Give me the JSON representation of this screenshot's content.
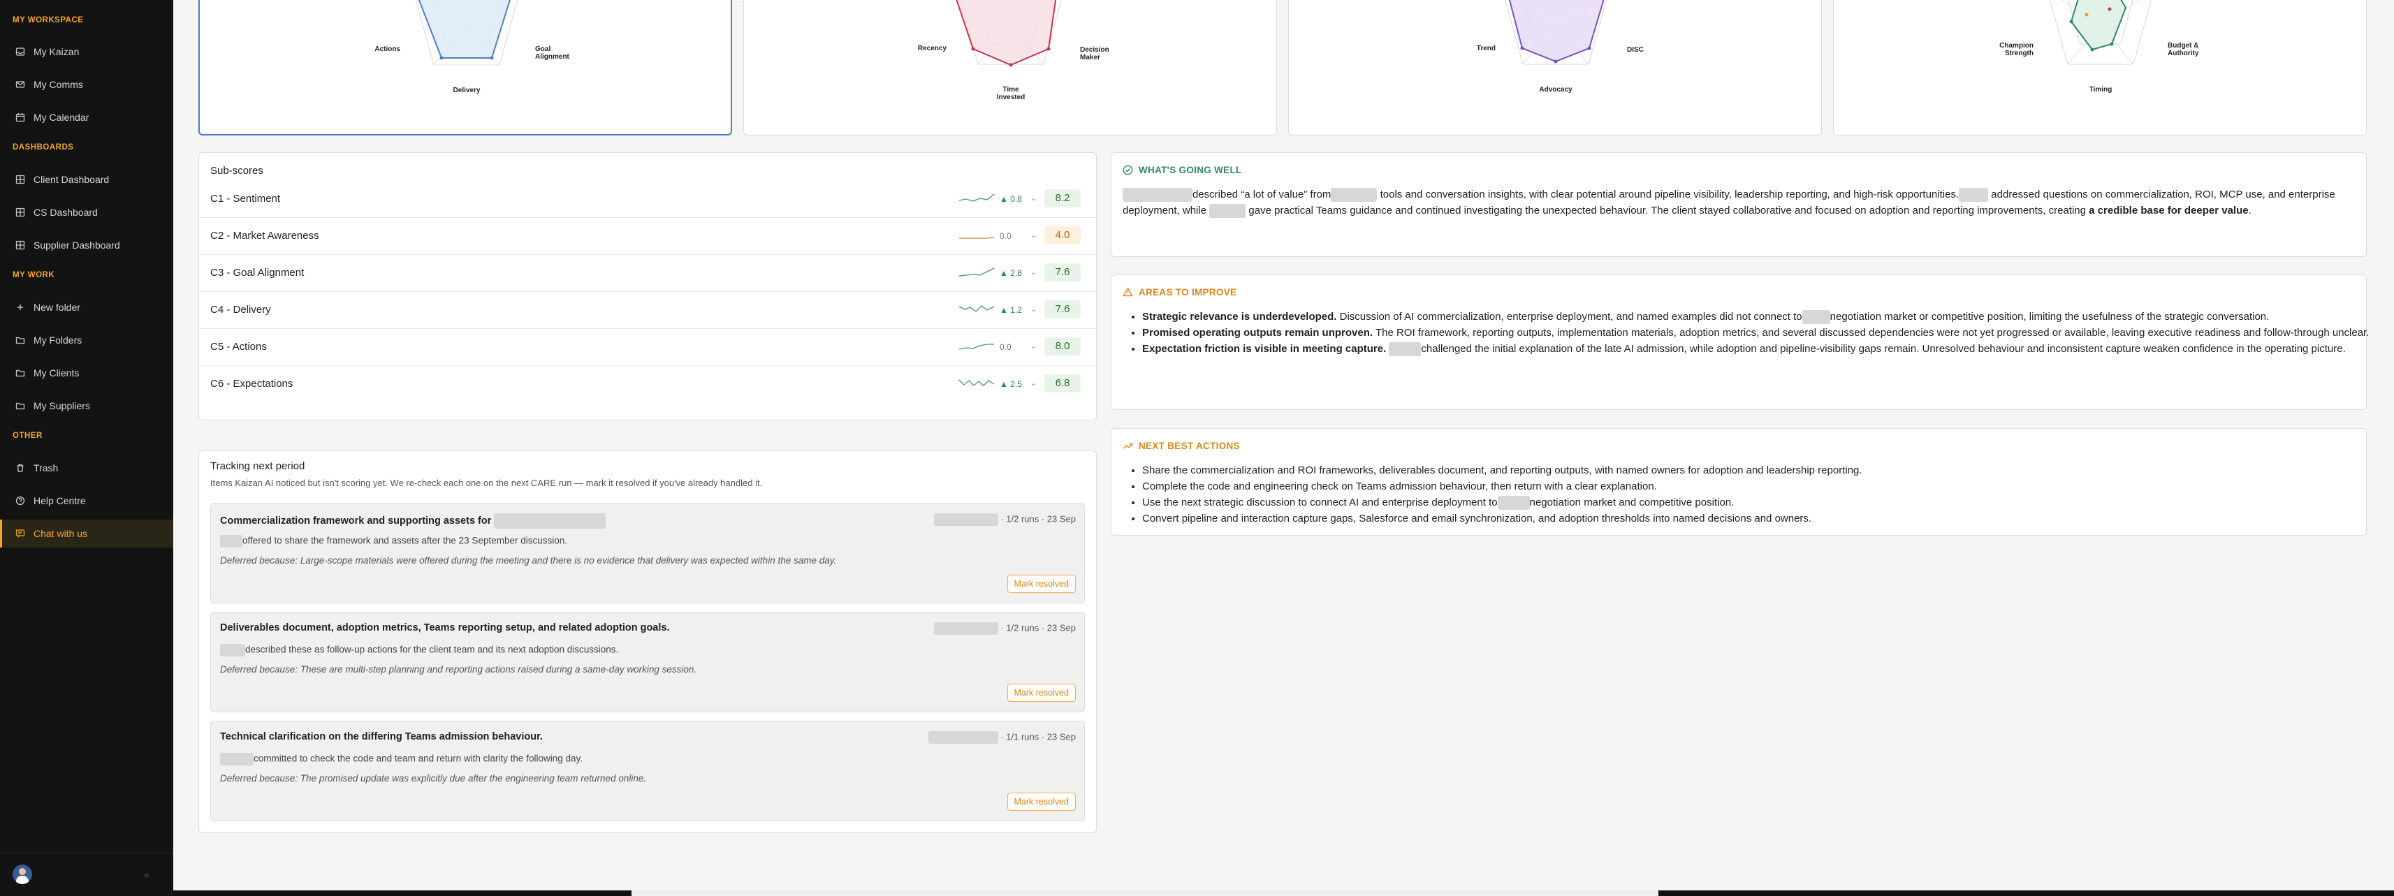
{
  "sidebar": {
    "sections": {
      "workspace": "MY WORKSPACE",
      "dashboards": "DASHBOARDS",
      "work": "MY WORK",
      "other": "OTHER"
    },
    "items": {
      "my_kaizan": "My Kaizan",
      "my_comms": "My Comms",
      "my_calendar": "My Calendar",
      "client_dashboard": "Client Dashboard",
      "cs_dashboard": "CS Dashboard",
      "supplier_dashboard": "Supplier Dashboard",
      "new_folder": "New folder",
      "my_folders": "My Folders",
      "my_clients": "My Clients",
      "my_suppliers": "My Suppliers",
      "trash": "Trash",
      "help_centre": "Help Centre",
      "chat_with_us": "Chat with us"
    },
    "collapse_icon": "chevron-double-left-icon",
    "accent": "#f5a623"
  },
  "radars": [
    {
      "labels": {
        "left": "Actions",
        "right": "Goal Alignment",
        "bottom": "Delivery"
      },
      "color": "#4a7fc1",
      "fill": "#dce8f6"
    },
    {
      "labels": {
        "left": "Recency",
        "right": "Decision Maker",
        "bottom": "Time Invested"
      },
      "color": "#c0394b",
      "fill": "#f6dde2"
    },
    {
      "labels": {
        "left": "Trend",
        "right": "DISC",
        "bottom": "Advocacy"
      },
      "color": "#7a4fc3",
      "fill": "#e7dcf6"
    },
    {
      "labels": {
        "left": "Champion Strength",
        "right": "Budget & Authority",
        "bottom": "Timing"
      },
      "color": "#2f8a5f",
      "fill": "#dcf0e5"
    }
  ],
  "subscores": {
    "title": "Sub-scores",
    "rows": [
      {
        "label": "C1 - Sentiment",
        "delta": "▲ 0.8",
        "score": "8.2",
        "tone": "green"
      },
      {
        "label": "C2 - Market Awareness",
        "delta": "0.0",
        "score": "4.0",
        "tone": "orange"
      },
      {
        "label": "C3 - Goal Alignment",
        "delta": "▲ 2.8",
        "score": "7.6",
        "tone": "green"
      },
      {
        "label": "C4 - Delivery",
        "delta": "▲ 1.2",
        "score": "7.6",
        "tone": "green"
      },
      {
        "label": "C5 - Actions",
        "delta": "0.0",
        "score": "8.0",
        "tone": "green"
      },
      {
        "label": "C6 - Expectations",
        "delta": "▲ 2.5",
        "score": "6.8",
        "tone": "green"
      }
    ]
  },
  "tracking": {
    "title": "Tracking next period",
    "subtitle": "Items Kaizan AI noticed but isn't scoring yet. We re-check each one on the next CARE run — mark it resolved if you've already handled it.",
    "items": [
      {
        "title": "Commercialization framework and supporting assets for",
        "meta": "· 1/2 runs · 23 Sep",
        "desc": "offered to share the framework and assets after the 23 September discussion.",
        "deferred": "Deferred because: Large-scope materials were offered during the meeting and there is no evidence that delivery was expected within the same day.",
        "button": "Mark resolved"
      },
      {
        "title": "Deliverables document, adoption metrics, Teams reporting setup, and related adoption goals.",
        "meta": "· 1/2 runs · 23 Sep",
        "desc": "described these as follow-up actions for the client team and its next adoption discussions.",
        "deferred": "Deferred because: These are multi-step planning and reporting actions raised during a same-day working session.",
        "button": "Mark resolved"
      },
      {
        "title": "Technical clarification on the differing Teams admission behaviour.",
        "meta": "· 1/1 runs · 23 Sep",
        "desc": "committed to check the code and team and return with clarity the following day.",
        "deferred": "Deferred because: The promised update was explicitly due after the engineering team returned online.",
        "button": "Mark resolved"
      }
    ]
  },
  "going_well": {
    "title": "WHAT'S GOING WELL",
    "color": "#2f8a5f",
    "p1": "described “a lot of value” from",
    "p2": "tools and conversation insights, with clear potential around pipeline visibility, leadership reporting, and high-risk opportunities.",
    "p3": "addressed questions on commercialization, ROI, MCP use, and enterprise deployment, while",
    "p4": "gave practical Teams guidance and continued investigating the unexpected behaviour. The client stayed collaborative and focused on adoption and reporting improvements, creating",
    "bold": "a credible base for deeper value",
    "end": "."
  },
  "improve": {
    "title": "AREAS TO IMPROVE",
    "color": "#d9861c",
    "items": [
      {
        "bold": "Strategic relevance is underdeveloped.",
        "a": "Discussion of AI commercialization, enterprise deployment, and named examples did not connect to",
        "b": "negotiation market or competitive position, limiting the usefulness of the strategic conversation."
      },
      {
        "bold": "Promised operating outputs remain unproven.",
        "a": "The ROI framework, reporting outputs, implementation materials, adoption metrics, and several discussed dependencies were not yet progressed or available, leaving executive readiness and follow-through unclear.",
        "b": ""
      },
      {
        "bold": "Expectation friction is visible in meeting capture.",
        "a": "",
        "b": "challenged the initial explanation of the late AI admission, while adoption and pipeline-visibility gaps remain. Unresolved behaviour and inconsistent capture weaken confidence in the operating picture."
      }
    ]
  },
  "next_actions": {
    "title": "NEXT BEST ACTIONS",
    "color": "#d9861c",
    "items": [
      {
        "a": "Share the commercialization and ROI frameworks, deliverables document, and reporting outputs, with named owners for adoption and leadership reporting.",
        "b": ""
      },
      {
        "a": "Complete the code and engineering check on Teams admission behaviour, then return with a clear explanation.",
        "b": ""
      },
      {
        "a": "Use the next strategic discussion to connect AI and enterprise deployment to",
        "b": "negotiation market and competitive position."
      },
      {
        "a": "Convert pipeline and interaction capture gaps, Salesforce and email synchronization, and adoption thresholds into named decisions and owners.",
        "b": ""
      }
    ]
  }
}
